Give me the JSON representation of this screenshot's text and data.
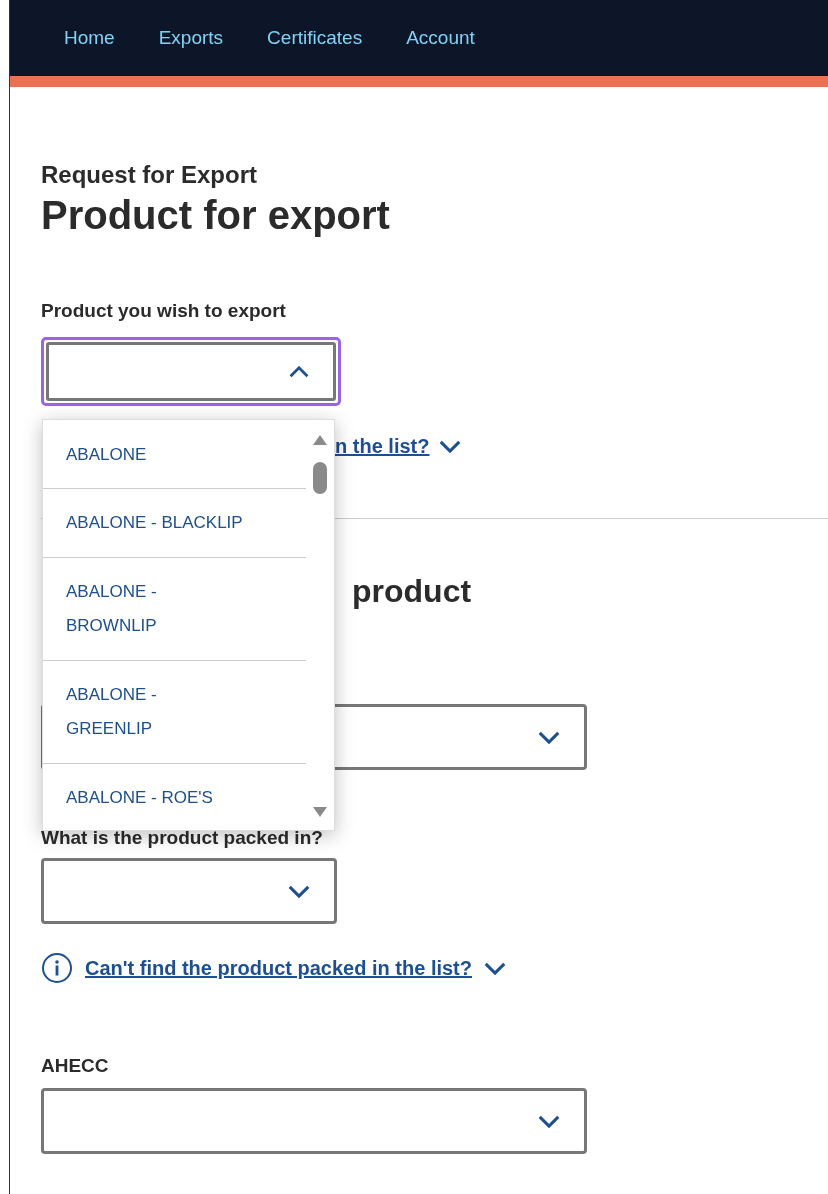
{
  "nav": {
    "items": [
      {
        "label": "Home"
      },
      {
        "label": "Exports"
      },
      {
        "label": "Certificates"
      },
      {
        "label": "Account"
      }
    ]
  },
  "page": {
    "caption": "Request for Export",
    "title": "Product for export"
  },
  "product": {
    "label": "Product you wish to export",
    "expanded": true,
    "help_link": "n the list?",
    "options": [
      {
        "label": "ABALONE"
      },
      {
        "label": "ABALONE - BLACKLIP"
      },
      {
        "label": "ABALONE - BROWNLIP"
      },
      {
        "label": "ABALONE - GREENLIP"
      },
      {
        "label": "ABALONE - ROE'S"
      }
    ]
  },
  "section": {
    "heading": "product",
    "select": {
      "expanded": false
    }
  },
  "packed_in": {
    "label": "What is the product packed in?",
    "expanded": false,
    "help_link": "Can't find the product packed in the list?"
  },
  "ahecc": {
    "label": "AHECC",
    "expanded": false
  }
}
